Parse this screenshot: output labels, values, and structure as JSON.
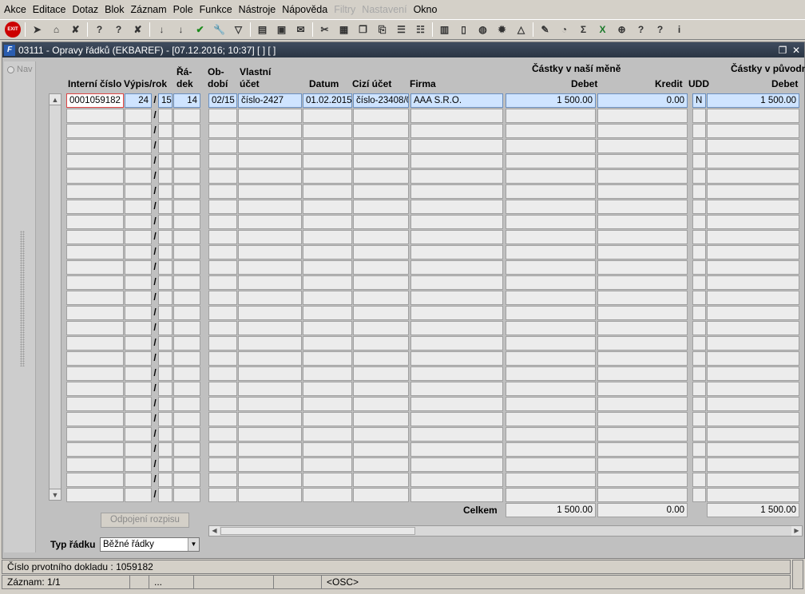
{
  "menu": [
    "Akce",
    "Editace",
    "Dotaz",
    "Blok",
    "Záznam",
    "Pole",
    "Funkce",
    "Nástroje",
    "Nápověda",
    "Filtry",
    "Nastavení",
    "Okno"
  ],
  "menu_disabled": [
    false,
    false,
    false,
    false,
    false,
    false,
    false,
    false,
    false,
    true,
    true,
    false
  ],
  "toolbar_icons": [
    "exit-icon",
    "sep",
    "arrow-key-icon",
    "go-record-icon",
    "clear-icon",
    "sep",
    "query-icon",
    "query-execute-icon",
    "query-cancel-icon",
    "sep",
    "sort-asc-icon",
    "sort-desc-icon",
    "check-icon",
    "wrench-icon",
    "filter-icon",
    "sep",
    "print-icon",
    "print-preview-icon",
    "mail-icon",
    "sep",
    "cut-icon",
    "paste-icon",
    "copy-icon",
    "attach-icon",
    "list-icon",
    "tree-icon",
    "sep",
    "clipboard-icon",
    "document-icon",
    "globe-icon",
    "settings-icon",
    "chart-icon",
    "sep",
    "edit-icon",
    "disk-icon",
    "sum-icon",
    "excel-icon",
    "export-icon",
    "help-icon",
    "whats-this-icon",
    "info-icon"
  ],
  "window": {
    "title": "03111 - Opravy řádků (EKBAREF) - [07.12.2016; 10:37] [ ] [ ]",
    "app_icon": "F"
  },
  "nav": {
    "label": "Nav"
  },
  "headers": {
    "interni": "Interní číslo",
    "vypis": "Výpis/rok",
    "radek1": "Řá-",
    "radek2": "dek",
    "obdobi1": "Ob-",
    "obdobi2": "dobí",
    "vlastni1": "Vlastní",
    "vlastni2": "účet",
    "datum": "Datum",
    "cizi": "Cizí účet",
    "firma": "Firma",
    "group_nase": "Částky v naší měně",
    "debet": "Debet",
    "kredit": "Kredit",
    "udd": "UDD",
    "group_puv": "Částky v původn",
    "debet2": "Debet"
  },
  "rows": [
    {
      "interni": "0001059182",
      "vypis": "24",
      "rok": "15",
      "radek": "14",
      "obdobi": "02/15",
      "vlastni": "číslo-2427",
      "datum": "01.02.2015",
      "cizi": "číslo-23408/0",
      "firma": "AAA S.R.O.",
      "debet": "1 500.00",
      "kredit": "0.00",
      "udd": "N",
      "debet2": "1 500.00"
    }
  ],
  "empty_row_count": 26,
  "totals": {
    "label": "Celkem",
    "debet": "1 500.00",
    "kredit": "0.00",
    "debet2": "1 500.00"
  },
  "buttons": {
    "odpojeni": "Odpojení rozpisu"
  },
  "typ_radku": {
    "label": "Typ řádku",
    "value": "Běžné řádky"
  },
  "status": {
    "line1": "Číslo prvotního dokladu : 1059182",
    "zaznam": "Záznam: 1/1",
    "seg3": "...",
    "osc": "<OSC>"
  }
}
